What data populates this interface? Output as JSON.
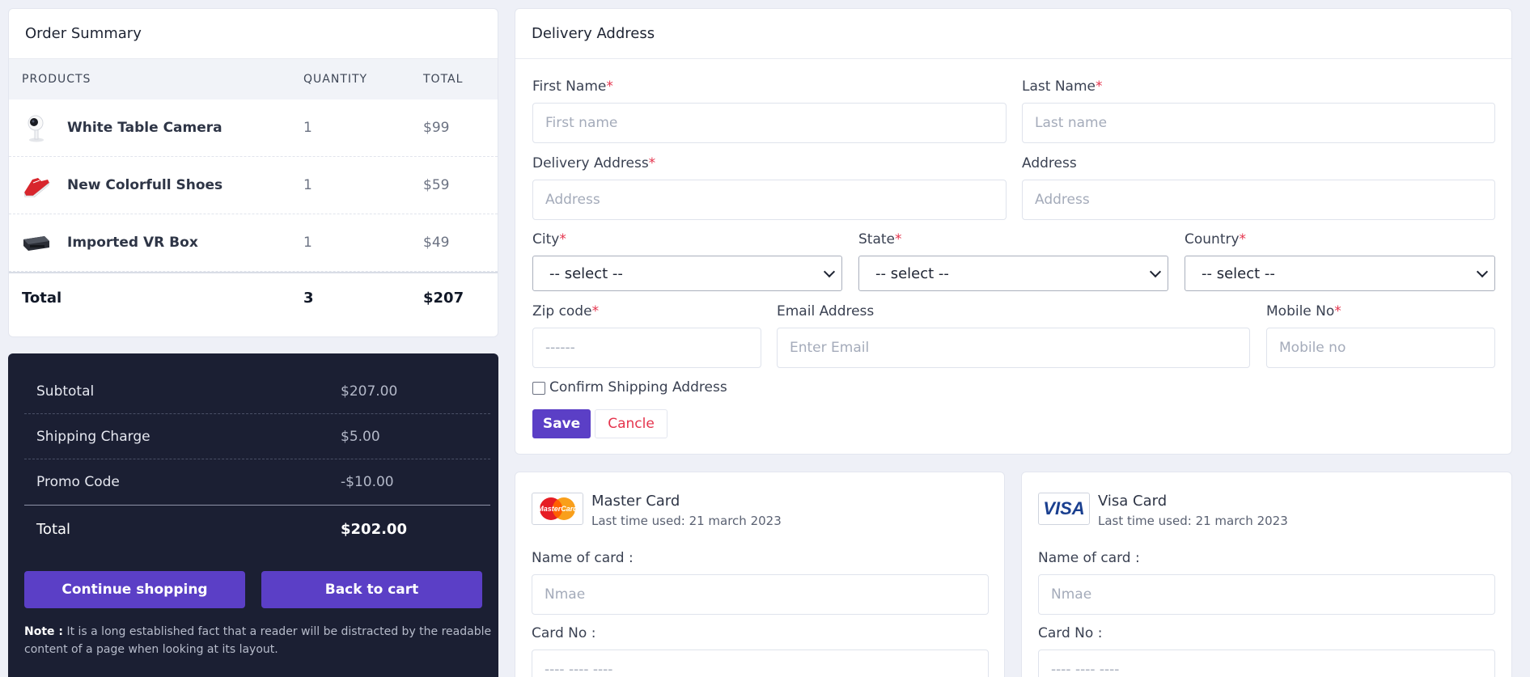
{
  "order_summary": {
    "title": "Order Summary",
    "headers": {
      "products": "PRODUCTS",
      "quantity": "QUANTITY",
      "total": "TOTAL"
    },
    "items": [
      {
        "name": "White Table Camera",
        "qty": "1",
        "total": "$99",
        "icon": "camera-icon"
      },
      {
        "name": "New Colorfull Shoes",
        "qty": "1",
        "total": "$59",
        "icon": "shoe-icon"
      },
      {
        "name": "Imported VR Box",
        "qty": "1",
        "total": "$49",
        "icon": "vr-box-icon"
      }
    ],
    "footer": {
      "label": "Total",
      "qty": "3",
      "total": "$207"
    }
  },
  "summary": {
    "rows": [
      {
        "label": "Subtotal",
        "value": "$207.00"
      },
      {
        "label": "Shipping Charge",
        "value": "$5.00"
      },
      {
        "label": "Promo Code",
        "value": "-$10.00"
      }
    ],
    "total": {
      "label": "Total",
      "value": "$202.00"
    },
    "continue_label": "Continue shopping",
    "back_label": "Back to cart",
    "note_title": "Note :",
    "note_text": " It is a long established fact that a reader will be distracted by the readable content of a page when looking at its layout."
  },
  "delivery": {
    "title": "Delivery Address",
    "first_name": {
      "label": "First Name",
      "required": "*",
      "placeholder": "First name"
    },
    "last_name": {
      "label": "Last Name",
      "required": "*",
      "placeholder": "Last name"
    },
    "delivery_address": {
      "label": "Delivery Address",
      "required": "*",
      "placeholder": "Address"
    },
    "address": {
      "label": "Address",
      "placeholder": "Address"
    },
    "city": {
      "label": "City",
      "required": "*",
      "value": "-- select --"
    },
    "state": {
      "label": "State",
      "required": "*",
      "value": "-- select --"
    },
    "country": {
      "label": "Country",
      "required": "*",
      "value": "-- select --"
    },
    "zip": {
      "label": "Zip code",
      "required": "*",
      "placeholder": "------"
    },
    "email": {
      "label": "Email Address",
      "placeholder": "Enter Email"
    },
    "mobile": {
      "label": "Mobile No",
      "required": "*",
      "placeholder": "Mobile no"
    },
    "confirm_label": "Confirm Shipping Address",
    "save_label": "Save",
    "cancel_label": "Cancle"
  },
  "payment": {
    "master": {
      "logo_text": "MasterCard",
      "title": "Master Card",
      "subtitle": "Last time used: 21 march 2023",
      "name_label": "Name of card :",
      "name_placeholder": "Nmae",
      "card_label": "Card No :",
      "card_placeholder": "---- ---- ----"
    },
    "visa": {
      "logo_text": "VISA",
      "title": "Visa Card",
      "subtitle": "Last time used: 21 march 2023",
      "name_label": "Name of card :",
      "name_placeholder": "Nmae",
      "card_label": "Card No :",
      "card_placeholder": "---- ---- ----"
    }
  },
  "colors": {
    "accent": "#5b3fc6",
    "dark_panel": "#1b1f33",
    "required": "#e5344d",
    "background": "#eef0f7"
  }
}
